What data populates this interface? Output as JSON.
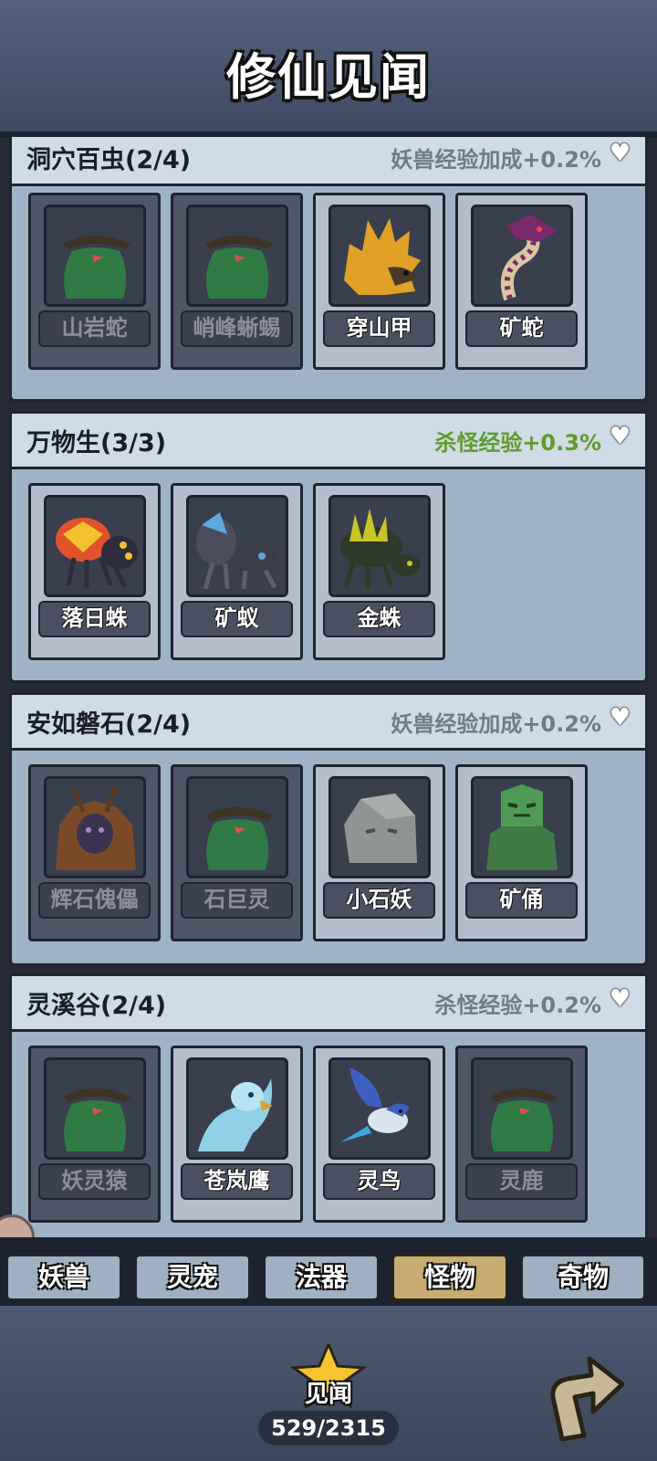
{
  "title": "修仙见闻",
  "sections": [
    {
      "title": "洞穴百虫(2/4)",
      "bonus": "妖兽经验加成+0.2%",
      "bonus_color": "#717b88",
      "cards": [
        {
          "name": "山岩蛇",
          "unlocked": false,
          "icon": "bird-silhouette-icon"
        },
        {
          "name": "峭峰蜥蜴",
          "unlocked": false,
          "icon": "bird-silhouette-icon"
        },
        {
          "name": "穿山甲",
          "unlocked": true,
          "icon": "pangolin-icon"
        },
        {
          "name": "矿蛇",
          "unlocked": true,
          "icon": "serpent-icon"
        }
      ]
    },
    {
      "title": "万物生(3/3)",
      "bonus": "杀怪经验+0.3%",
      "bonus_color": "#5f9c2d",
      "cards": [
        {
          "name": "落日蛛",
          "unlocked": true,
          "icon": "spider-icon"
        },
        {
          "name": "矿蚁",
          "unlocked": true,
          "icon": "ant-icon"
        },
        {
          "name": "金蛛",
          "unlocked": true,
          "icon": "golden-spider-icon"
        }
      ]
    },
    {
      "title": "安如磐石(2/4)",
      "bonus": "妖兽经验加成+0.2%",
      "bonus_color": "#717b88",
      "cards": [
        {
          "name": "辉石傀儡",
          "unlocked": false,
          "icon": "golem-icon"
        },
        {
          "name": "石巨灵",
          "unlocked": false,
          "icon": "bird-silhouette-icon"
        },
        {
          "name": "小石妖",
          "unlocked": true,
          "icon": "rock-icon"
        },
        {
          "name": "矿俑",
          "unlocked": true,
          "icon": "jade-warrior-icon"
        }
      ]
    },
    {
      "title": "灵溪谷(2/4)",
      "bonus": "杀怪经验+0.2%",
      "bonus_color": "#717b88",
      "cards": [
        {
          "name": "妖灵猿",
          "unlocked": false,
          "icon": "bird-silhouette-icon"
        },
        {
          "name": "苍岚鹰",
          "unlocked": true,
          "icon": "eagle-icon"
        },
        {
          "name": "灵鸟",
          "unlocked": true,
          "icon": "blue-bird-icon"
        },
        {
          "name": "灵鹿",
          "unlocked": false,
          "icon": "bird-silhouette-icon"
        }
      ]
    }
  ],
  "tabs": [
    {
      "label": "妖兽",
      "active": false
    },
    {
      "label": "灵宠",
      "active": false
    },
    {
      "label": "法器",
      "active": false
    },
    {
      "label": "怪物",
      "active": true
    },
    {
      "label": "奇物",
      "active": false
    }
  ],
  "footer": {
    "badge_label": "见闻",
    "progress": "529/2315",
    "progress_fraction": 0.2285
  },
  "colors": {
    "panel": "#9fb3c6",
    "header": "#cfdbe6",
    "active_tab": "#c7ad72",
    "bonus_green": "#5f9c2d"
  }
}
